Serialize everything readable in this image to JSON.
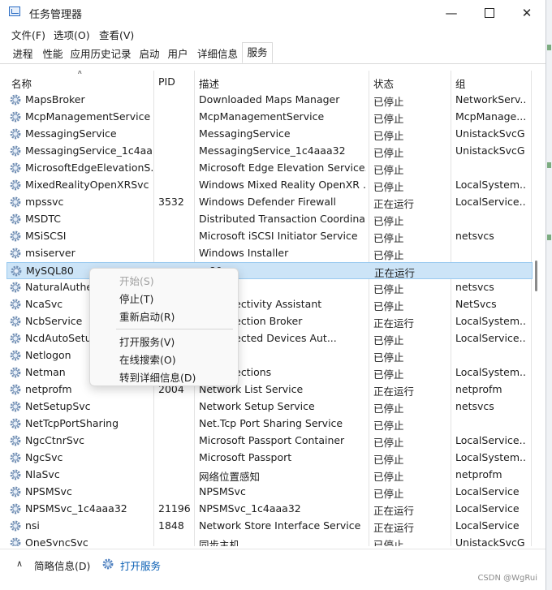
{
  "window": {
    "title": "任务管理器"
  },
  "menu": [
    "文件(F)",
    "选项(O)",
    "查看(V)"
  ],
  "tabs": [
    "进程",
    "性能",
    "应用历史记录",
    "启动",
    "用户",
    "详细信息",
    "服务"
  ],
  "active_tab": "服务",
  "columns": {
    "name": "名称",
    "pid": "PID",
    "desc": "描述",
    "status": "状态",
    "group": "组"
  },
  "rows": [
    {
      "name": "MapsBroker",
      "pid": "",
      "desc": "Downloaded Maps Manager",
      "status": "已停止",
      "group": "NetworkServ..."
    },
    {
      "name": "McpManagementService",
      "pid": "",
      "desc": "McpManagementService",
      "status": "已停止",
      "group": "McpManage..."
    },
    {
      "name": "MessagingService",
      "pid": "",
      "desc": "MessagingService",
      "status": "已停止",
      "group": "UnistackSvcG..."
    },
    {
      "name": "MessagingService_1c4aa...",
      "pid": "",
      "desc": "MessagingService_1c4aaa32",
      "status": "已停止",
      "group": "UnistackSvcG..."
    },
    {
      "name": "MicrosoftEdgeElevationS...",
      "pid": "",
      "desc": "Microsoft Edge Elevation Service...",
      "status": "已停止",
      "group": ""
    },
    {
      "name": "MixedRealityOpenXRSvc",
      "pid": "",
      "desc": "Windows Mixed Reality OpenXR ...",
      "status": "已停止",
      "group": "LocalSystem..."
    },
    {
      "name": "mpssvc",
      "pid": "3532",
      "desc": "Windows Defender Firewall",
      "status": "正在运行",
      "group": "LocalService..."
    },
    {
      "name": "MSDTC",
      "pid": "",
      "desc": "Distributed Transaction Coordina...",
      "status": "已停止",
      "group": ""
    },
    {
      "name": "MSiSCSI",
      "pid": "",
      "desc": "Microsoft iSCSI Initiator Service",
      "status": "已停止",
      "group": "netsvcs"
    },
    {
      "name": "msiserver",
      "pid": "",
      "desc": "Windows Installer",
      "status": "已停止",
      "group": ""
    },
    {
      "name": "MySQL80",
      "pid": "",
      "desc": "...80",
      "status": "正在运行",
      "group": ""
    },
    {
      "name": "NaturalAuthen...",
      "pid": "",
      "desc": "...验证",
      "status": "已停止",
      "group": "netsvcs"
    },
    {
      "name": "NcaSvc",
      "pid": "",
      "desc": "...Connectivity Assistant",
      "status": "已停止",
      "group": "NetSvcs"
    },
    {
      "name": "NcbService",
      "pid": "",
      "desc": "...Connection Broker",
      "status": "正在运行",
      "group": "LocalSystem..."
    },
    {
      "name": "NcdAutoSetup...",
      "pid": "",
      "desc": "...Connected Devices Aut...",
      "status": "已停止",
      "group": "LocalService..."
    },
    {
      "name": "Netlogon",
      "pid": "",
      "desc": "...n",
      "status": "已停止",
      "group": ""
    },
    {
      "name": "Netman",
      "pid": "",
      "desc": "...Connections",
      "status": "已停止",
      "group": "LocalSystem..."
    },
    {
      "name": "netprofm",
      "pid": "2004",
      "desc": "Network List Service",
      "status": "正在运行",
      "group": "netprofm"
    },
    {
      "name": "NetSetupSvc",
      "pid": "",
      "desc": "Network Setup Service",
      "status": "已停止",
      "group": "netsvcs"
    },
    {
      "name": "NetTcpPortSharing",
      "pid": "",
      "desc": "Net.Tcp Port Sharing Service",
      "status": "已停止",
      "group": ""
    },
    {
      "name": "NgcCtnrSvc",
      "pid": "",
      "desc": "Microsoft Passport Container",
      "status": "已停止",
      "group": "LocalService..."
    },
    {
      "name": "NgcSvc",
      "pid": "",
      "desc": "Microsoft Passport",
      "status": "已停止",
      "group": "LocalSystem..."
    },
    {
      "name": "NlaSvc",
      "pid": "",
      "desc": "网络位置感知",
      "status": "已停止",
      "group": "netprofm"
    },
    {
      "name": "NPSMSvc",
      "pid": "",
      "desc": "NPSMSvc",
      "status": "已停止",
      "group": "LocalService"
    },
    {
      "name": "NPSMSvc_1c4aaa32",
      "pid": "21196",
      "desc": "NPSMSvc_1c4aaa32",
      "status": "正在运行",
      "group": "LocalService"
    },
    {
      "name": "nsi",
      "pid": "1848",
      "desc": "Network Store Interface Service",
      "status": "正在运行",
      "group": "LocalService"
    },
    {
      "name": "OneSyncSvc",
      "pid": "",
      "desc": "同步主机",
      "status": "已停止",
      "group": "UnistackSvcG..."
    }
  ],
  "context_menu": [
    "开始(S)",
    "停止(T)",
    "重新启动(R)",
    "打开服务(V)",
    "在线搜索(O)",
    "转到详细信息(D)"
  ],
  "footer": {
    "fewer_details": "简略信息(D)",
    "open_services": "打开服务",
    "watermark": "CSDN @WgRui"
  }
}
